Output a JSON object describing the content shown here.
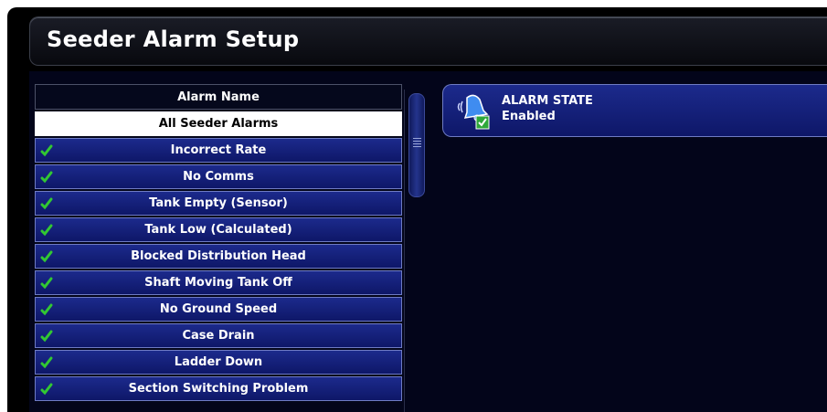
{
  "title": "Seeder Alarm Setup",
  "list": {
    "header": "Alarm Name",
    "items": [
      {
        "label": "All Seeder Alarms",
        "selected": true,
        "checked": false
      },
      {
        "label": "Incorrect Rate",
        "selected": false,
        "checked": true
      },
      {
        "label": "No Comms",
        "selected": false,
        "checked": true
      },
      {
        "label": "Tank Empty (Sensor)",
        "selected": false,
        "checked": true
      },
      {
        "label": "Tank Low (Calculated)",
        "selected": false,
        "checked": true
      },
      {
        "label": "Blocked Distribution Head",
        "selected": false,
        "checked": true
      },
      {
        "label": "Shaft Moving Tank Off",
        "selected": false,
        "checked": true
      },
      {
        "label": "No Ground Speed",
        "selected": false,
        "checked": true
      },
      {
        "label": "Case Drain",
        "selected": false,
        "checked": true
      },
      {
        "label": "Ladder Down",
        "selected": false,
        "checked": true
      },
      {
        "label": "Section Switching Problem",
        "selected": false,
        "checked": true
      }
    ]
  },
  "alarm_state": {
    "label": "ALARM STATE",
    "value": "Enabled",
    "icon": "bell-enabled-icon"
  },
  "colors": {
    "row_fill": "#1c2a8c",
    "row_border": "#6f7cc4",
    "check_green": "#32c832",
    "background": "#03051a"
  }
}
